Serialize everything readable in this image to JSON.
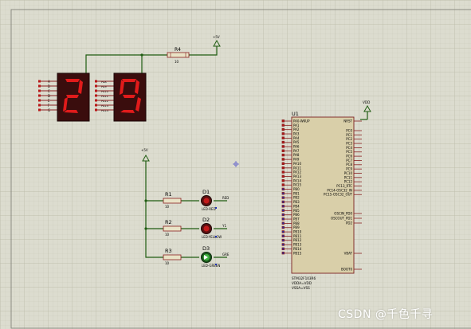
{
  "resistors": [
    {
      "ref": "R4",
      "value": "10"
    },
    {
      "ref": "R1",
      "value": "10"
    },
    {
      "ref": "R2",
      "value": "10"
    },
    {
      "ref": "R3",
      "value": "10"
    }
  ],
  "power": [
    {
      "label": "+5V"
    },
    {
      "label": "+5V"
    },
    {
      "label": "VDD"
    }
  ],
  "display": {
    "digit1": "2",
    "digit2": "9",
    "left_pins": [
      "A",
      "B",
      "C",
      "D",
      "E",
      "F",
      "G"
    ],
    "right_pins": [
      "PA8",
      "PA9",
      "PA10",
      "PA11",
      "PA12",
      "PA13",
      "PA14"
    ]
  },
  "leds": [
    {
      "ref": "D1",
      "name": "LED-RED",
      "net": "RED",
      "color": "#c21a1a"
    },
    {
      "ref": "D2",
      "name": "LED-YELLOW",
      "net": "Y1",
      "color": "#c21a1a"
    },
    {
      "ref": "D3",
      "name": "LED-GREEN",
      "net": "GRE",
      "color": "#3fb33f"
    }
  ],
  "mcu": {
    "ref": "U1",
    "part": "STM32F103R6",
    "pins_left": [
      "PA0-WKUP",
      "PA1",
      "PA2",
      "PA3",
      "PA4",
      "PA5",
      "PA6",
      "PA7",
      "PA8",
      "PA9",
      "PA10",
      "PA11",
      "PA12",
      "PA13",
      "PA14",
      "PA15",
      "PB0",
      "PB1",
      "PB2",
      "PB3",
      "PB4",
      "PB5",
      "PB6",
      "PB7",
      "PB8",
      "PB9",
      "PB10",
      "PB11",
      "PB12",
      "PB13",
      "PB14",
      "PB15"
    ],
    "pins_right_top": [
      "NRST",
      "PC0",
      "PC1",
      "PC2",
      "PC3",
      "PC4",
      "PC5",
      "PC6",
      "PC7",
      "PC8",
      "PC9",
      "PC10",
      "PC11",
      "PC12",
      "PC13_RTC",
      "PC14-OSC32_IN",
      "PC15-OSC32_OUT"
    ],
    "pins_right_mid": [
      "OSCIN_PD0",
      "OSCOUT_PD1",
      "PD2"
    ],
    "pins_right_bottom": [
      "VBAT",
      "BOOT0"
    ],
    "power_notes": [
      "VDDA=VDD",
      "VSSA=VSS"
    ]
  },
  "watermark": "CSDN @千色千寻"
}
